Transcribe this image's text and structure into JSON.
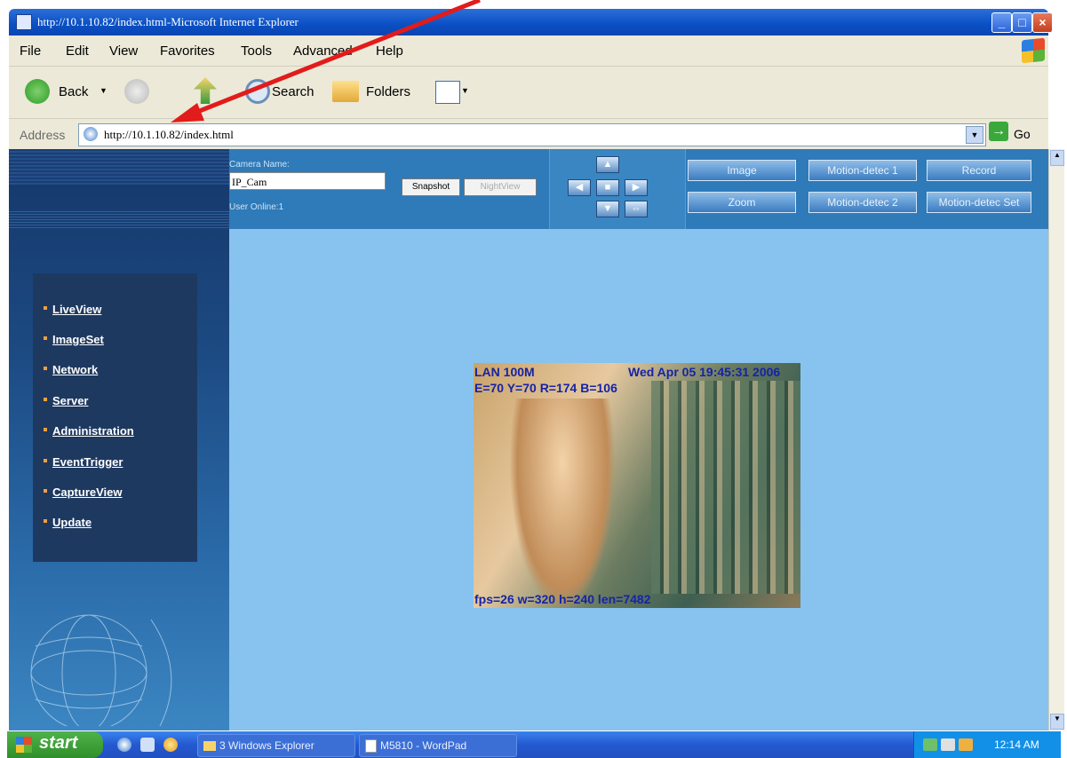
{
  "window": {
    "title": "http://10.1.10.82/index.html-Microsoft Internet Explorer",
    "minimize_glyph": "_",
    "maximize_glyph": "□",
    "close_glyph": "×"
  },
  "menubar": {
    "items": [
      "File",
      "Edit",
      "View",
      "Favorites",
      "Tools",
      "Advanced",
      "Help"
    ]
  },
  "toolbar": {
    "back_label": "Back",
    "search_label": "Search",
    "folders_label": "Folders",
    "dropdown_glyph": "▼"
  },
  "address": {
    "label": "Address",
    "url": "http://10.1.10.82/index.html",
    "go_label": "Go",
    "go_glyph": "→"
  },
  "camera_panel": {
    "camera_name_label": "Camera Name:",
    "camera_name_value": "IP_Cam",
    "snapshot_label": "Snapshot",
    "nightview_label": "NightView",
    "user_online_label": "User Online:1"
  },
  "function_buttons": [
    "Image",
    "Motion-detec 1",
    "Record",
    "Zoom",
    "Motion-detec 2",
    "Motion-detec Set"
  ],
  "sidebar": {
    "items": [
      "LiveView",
      "ImageSet",
      "Network",
      "Server",
      "Administration",
      "EventTrigger",
      "CaptureView",
      "Update"
    ]
  },
  "video": {
    "overlay_top_left": "LAN 100M",
    "overlay_top_right": "Wed Apr 05 19:45:31 2006",
    "overlay_line2": "E=70 Y=70 R=174 B=106",
    "overlay_bottom": "fps=26 w=320 h=240 len=7482"
  },
  "taskbar": {
    "start_label": "start",
    "tasks": [
      "3 Windows Explorer",
      "M5810 - WordPad"
    ],
    "clock": "12:14 AM"
  }
}
